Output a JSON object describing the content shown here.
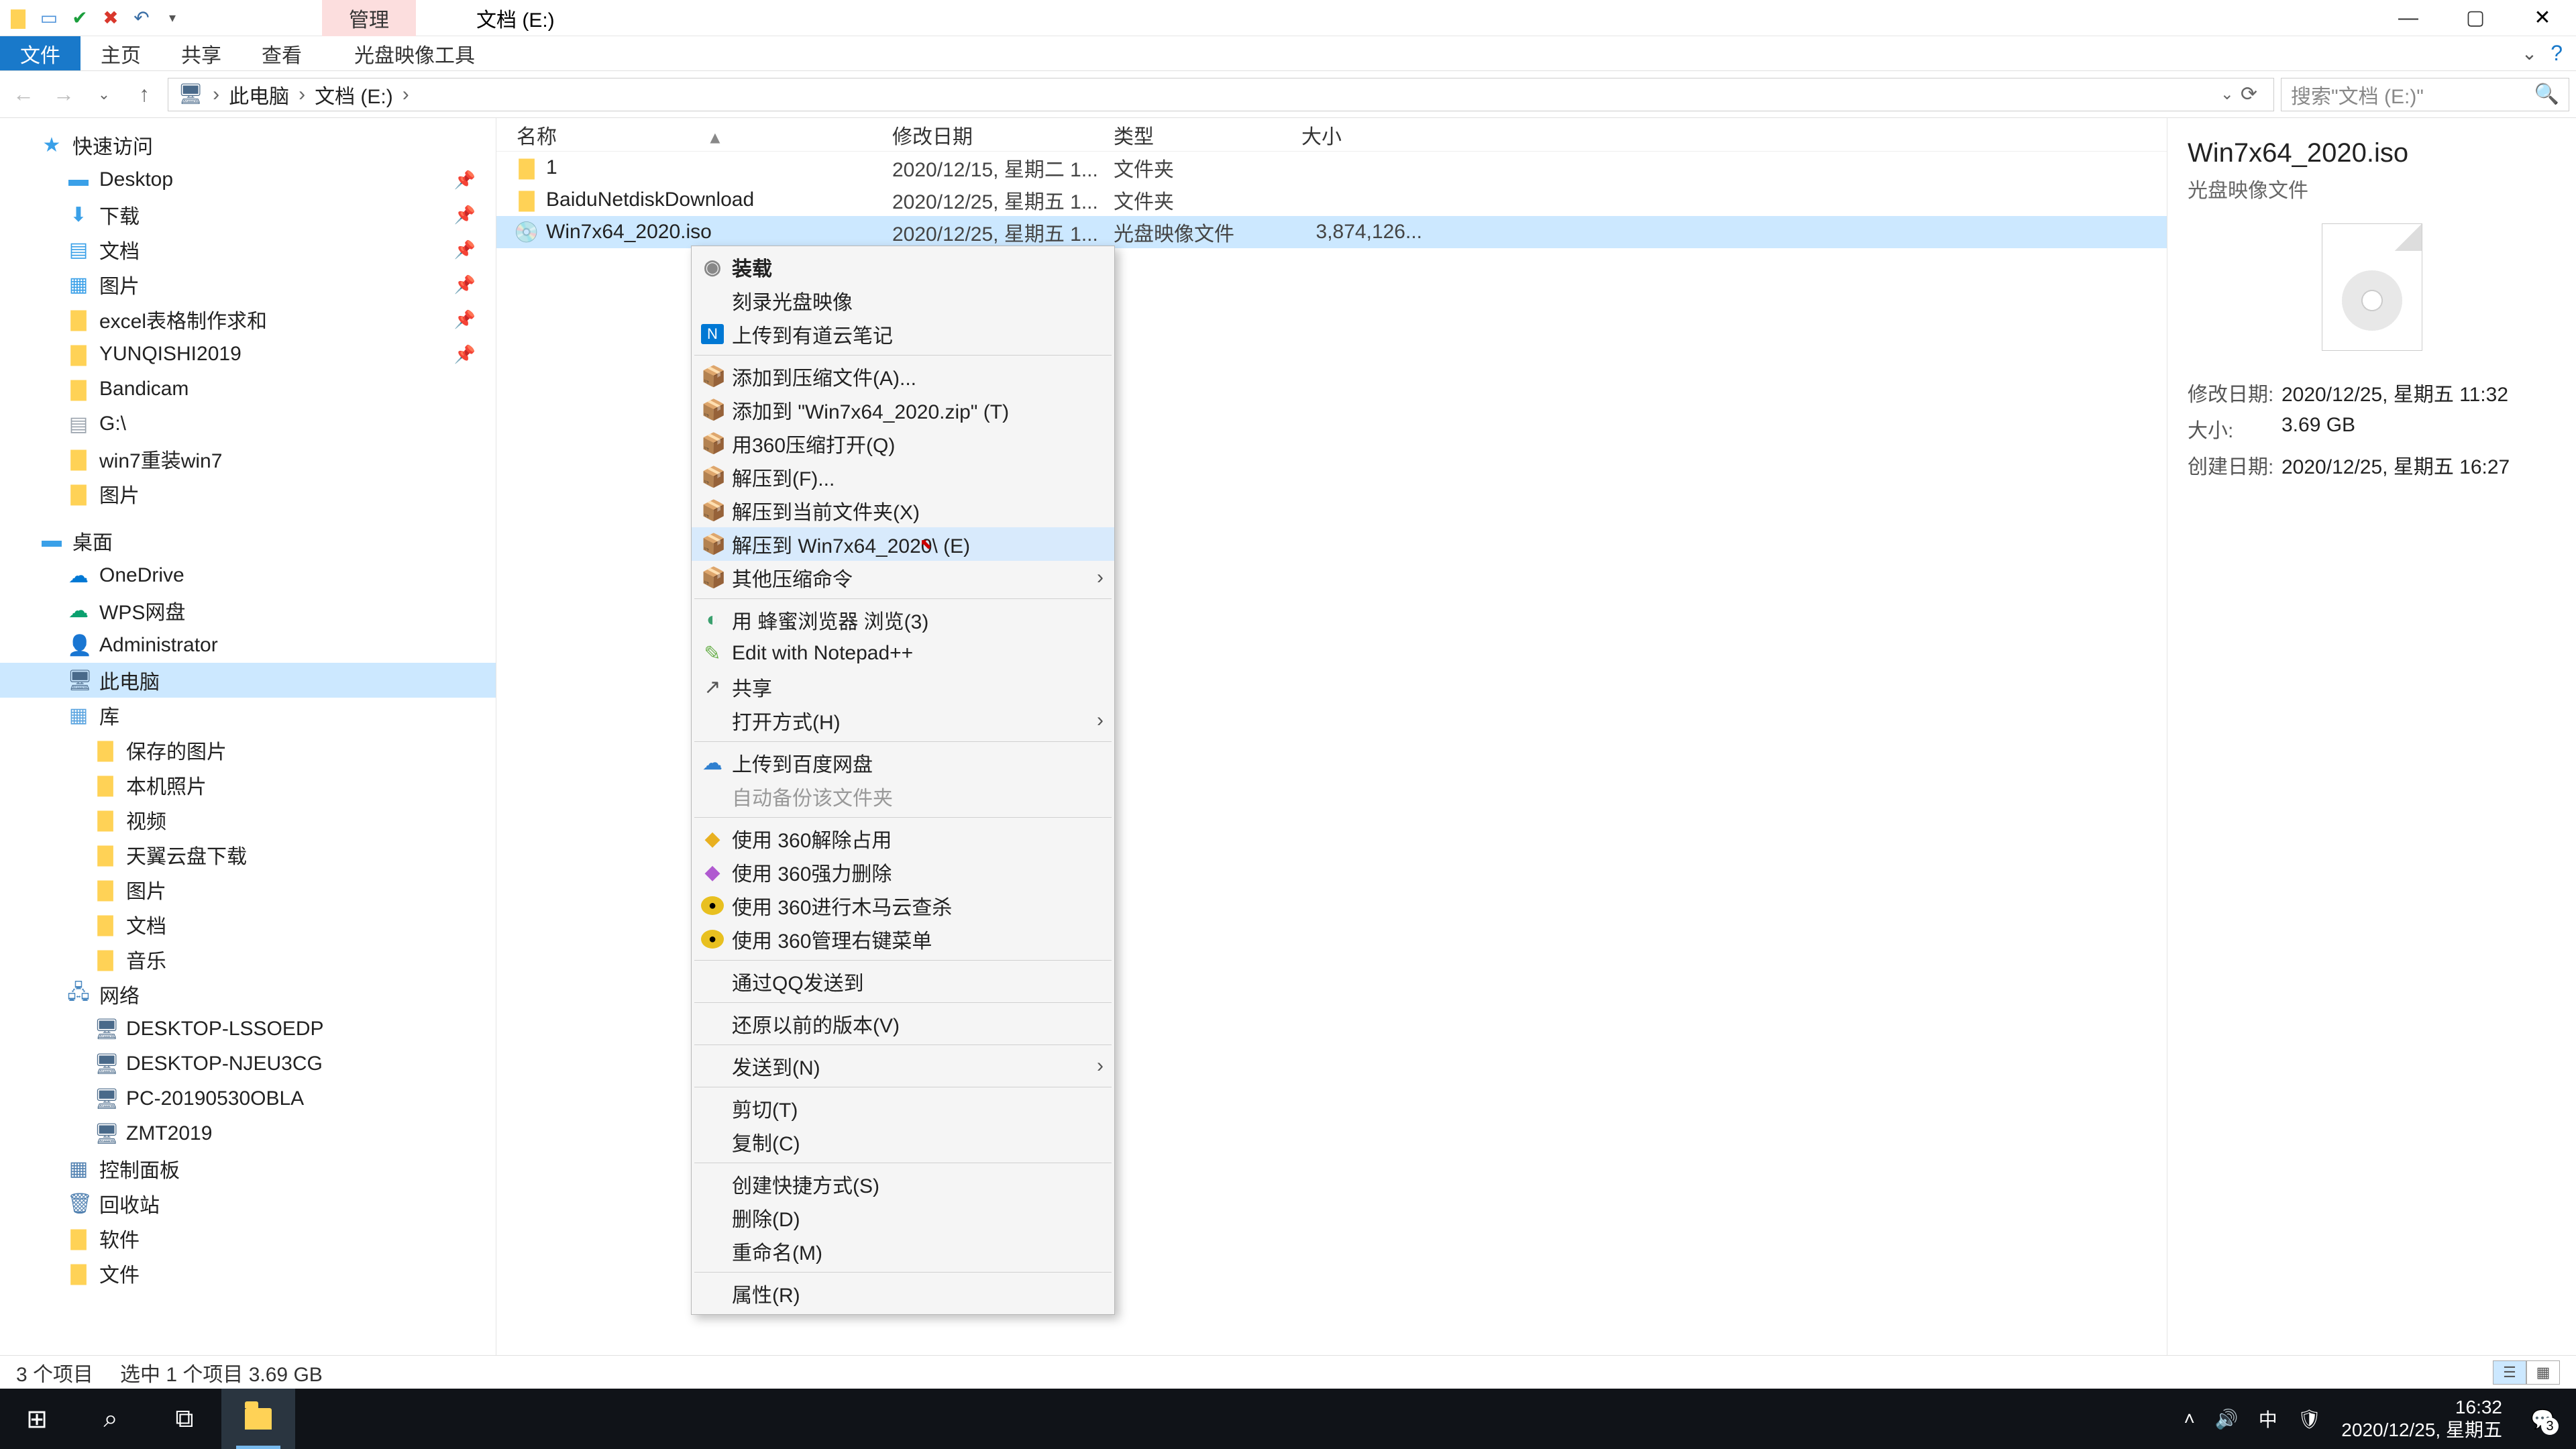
{
  "titlebar": {
    "contextual_tab": "管理",
    "window_title": "文档 (E:)"
  },
  "ribbon": {
    "tabs": [
      "文件",
      "主页",
      "共享",
      "查看",
      "光盘映像工具"
    ]
  },
  "breadcrumb": {
    "root": "此电脑",
    "loc": "文档 (E:)"
  },
  "search": {
    "placeholder": "搜索\"文档 (E:)\""
  },
  "columns": {
    "name": "名称",
    "date": "修改日期",
    "type": "类型",
    "size": "大小"
  },
  "rows": [
    {
      "icon": "folder",
      "name": "1",
      "date": "2020/12/15, 星期二 1...",
      "type": "文件夹",
      "size": ""
    },
    {
      "icon": "folder",
      "name": "BaiduNetdiskDownload",
      "date": "2020/12/25, 星期五 1...",
      "type": "文件夹",
      "size": ""
    },
    {
      "icon": "iso",
      "name": "Win7x64_2020.iso",
      "date": "2020/12/25, 星期五 1...",
      "type": "光盘映像文件",
      "size": "3,874,126..."
    }
  ],
  "navtree": {
    "quick": "快速访问",
    "quick_items": [
      "Desktop",
      "下载",
      "文档",
      "图片",
      "excel表格制作求和",
      "YUNQISHI2019",
      "Bandicam",
      "G:\\",
      "win7重装win7",
      "图片"
    ],
    "desktop": "桌面",
    "onedrive": "OneDrive",
    "wps": "WPS网盘",
    "admin": "Administrator",
    "thispc": "此电脑",
    "lib": "库",
    "lib_items": [
      "保存的图片",
      "本机照片",
      "视频",
      "天翼云盘下载",
      "图片",
      "文档",
      "音乐"
    ],
    "network": "网络",
    "net_items": [
      "DESKTOP-LSSOEDP",
      "DESKTOP-NJEU3CG",
      "PC-20190530OBLA",
      "ZMT2019"
    ],
    "panel": "控制面板",
    "recycle": "回收站",
    "soft": "软件",
    "files": "文件"
  },
  "ctx": {
    "items": [
      {
        "icon": "mount",
        "label": "装载",
        "bold": true
      },
      {
        "label": "刻录光盘映像"
      },
      {
        "icon": "note",
        "label": "上传到有道云笔记"
      },
      {
        "sep": true
      },
      {
        "icon": "zip",
        "label": "添加到压缩文件(A)..."
      },
      {
        "icon": "zip",
        "label": "添加到 \"Win7x64_2020.zip\" (T)"
      },
      {
        "icon": "zip360",
        "label": "用360压缩打开(Q)"
      },
      {
        "icon": "zip360",
        "label": "解压到(F)..."
      },
      {
        "icon": "zip360",
        "label": "解压到当前文件夹(X)"
      },
      {
        "icon": "zip360",
        "label": "解压到 Win7x64_2020\\ (E)",
        "hover": true
      },
      {
        "icon": "zip360",
        "label": "其他压缩命令",
        "arrow": true
      },
      {
        "sep": true
      },
      {
        "icon": "browser",
        "label": "用 蜂蜜浏览器 浏览(3)"
      },
      {
        "icon": "npp",
        "label": "Edit with Notepad++"
      },
      {
        "icon": "share",
        "label": "共享"
      },
      {
        "label": "打开方式(H)",
        "arrow": true
      },
      {
        "sep": true
      },
      {
        "icon": "baidu",
        "label": "上传到百度网盘"
      },
      {
        "label": "自动备份该文件夹",
        "disabled": true
      },
      {
        "sep": true
      },
      {
        "icon": "s360a",
        "label": "使用 360解除占用"
      },
      {
        "icon": "s360b",
        "label": "使用 360强力删除"
      },
      {
        "icon": "s360c",
        "label": "使用 360进行木马云查杀"
      },
      {
        "icon": "s360d",
        "label": "使用 360管理右键菜单"
      },
      {
        "sep": true
      },
      {
        "label": "通过QQ发送到"
      },
      {
        "sep": true
      },
      {
        "label": "还原以前的版本(V)"
      },
      {
        "sep": true
      },
      {
        "label": "发送到(N)",
        "arrow": true
      },
      {
        "sep": true
      },
      {
        "label": "剪切(T)"
      },
      {
        "label": "复制(C)"
      },
      {
        "sep": true
      },
      {
        "label": "创建快捷方式(S)"
      },
      {
        "label": "删除(D)"
      },
      {
        "label": "重命名(M)"
      },
      {
        "sep": true
      },
      {
        "label": "属性(R)"
      }
    ]
  },
  "details": {
    "name": "Win7x64_2020.iso",
    "type": "光盘映像文件",
    "meta": {
      "mod_k": "修改日期:",
      "mod_v": "2020/12/25, 星期五 11:32",
      "size_k": "大小:",
      "size_v": "3.69 GB",
      "create_k": "创建日期:",
      "create_v": "2020/12/25, 星期五 16:27"
    }
  },
  "status": {
    "count": "3 个项目",
    "sel": "选中 1 个项目  3.69 GB"
  },
  "taskbar": {
    "ime": "中",
    "time": "16:32",
    "date": "2020/12/25, 星期五",
    "notif_count": "3"
  }
}
